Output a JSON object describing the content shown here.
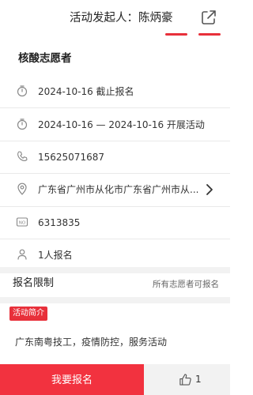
{
  "header": {
    "organizer_label": "活动发起人：陈炳豪",
    "share_icon": "share-icon",
    "accent_color": "#e8303a"
  },
  "activity": {
    "title": "核酸志愿者",
    "deadline": "2024-10-16 截止报名",
    "period": "2024-10-16 — 2024-10-16 开展活动",
    "phone": "15625071687",
    "address": "广东省广州市从化市广东省广州市从...",
    "id_number": "6313835",
    "signups": "1人报名"
  },
  "limits": {
    "label": "报名限制",
    "value": "所有志愿者可报名"
  },
  "intro": {
    "badge": "活动简介",
    "text": "广东南粤技工，疫情防控，服务活动"
  },
  "bottom": {
    "signup_label": "我要报名",
    "like_count": "1",
    "signup_color": "#f2323f"
  }
}
